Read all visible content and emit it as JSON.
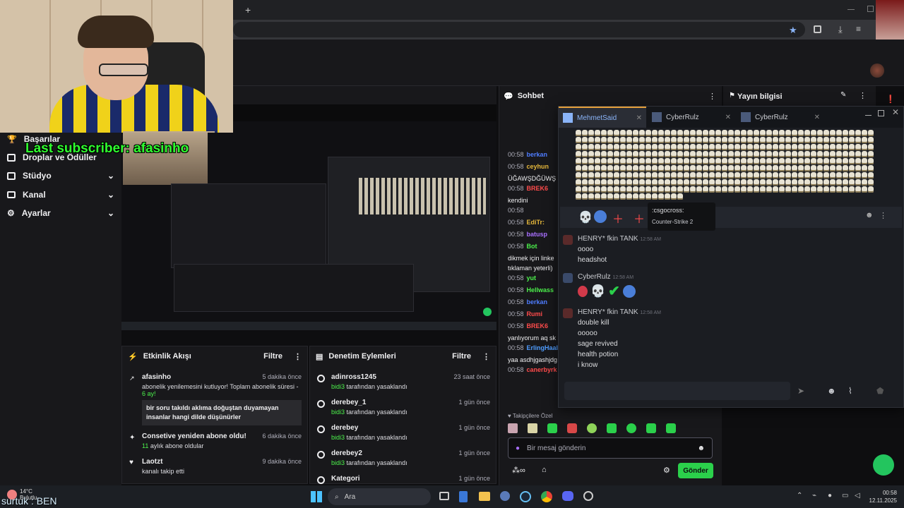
{
  "browser": {
    "new_tab_symbol": "+",
    "bookmark_icon": "star-icon"
  },
  "overlay": {
    "last_subscriber": "Last subscriber: afasinho",
    "bottom_label": "surtuk : BEN"
  },
  "sidebar": {
    "items": [
      {
        "label": "Başarılar",
        "icon": "trophy-icon",
        "chevron": false
      },
      {
        "label": "Droplar ve Ödüller",
        "icon": "gift-icon",
        "chevron": false
      },
      {
        "label": "Stüdyo",
        "icon": "film-icon",
        "chevron": true
      },
      {
        "label": "Kanal",
        "icon": "channel-icon",
        "chevron": true
      },
      {
        "label": "Ayarlar",
        "icon": "gear-icon",
        "chevron": true
      }
    ]
  },
  "activity": {
    "title": "Etkinlik Akışı",
    "filter_label": "Filtre",
    "events": [
      {
        "user": "afasinho",
        "time": "5 dakika önce",
        "text": "abonelik yenilemesini kutluyor! Toplam abonelik süresi - ",
        "highlight": "6 ay!",
        "message": "bir soru takıldı aklıma doğuştan duyamayan insanlar hangi dilde düşünürler"
      },
      {
        "user": "Consetive yeniden abone oldu!",
        "time": "6 dakika önce",
        "highlight": "11",
        "text": " aylık abone oldular"
      },
      {
        "user": "Laotzt",
        "time": "9 dakika önce",
        "text": "kanalı takip etti"
      }
    ]
  },
  "moderation": {
    "title": "Denetim Eylemleri",
    "filter_label": "Filtre",
    "actions": [
      {
        "user": "adinross1245",
        "time": "23 saat önce",
        "by": "bidi3",
        "text": " tarafından yasaklandı"
      },
      {
        "user": "derebey_1",
        "time": "1 gün önce",
        "by": "bidi3",
        "text": " tarafından yasaklandı"
      },
      {
        "user": "derebey",
        "time": "1 gün önce",
        "by": "bidi3",
        "text": " tarafından yasaklandı"
      },
      {
        "user": "derebey2",
        "time": "1 gün önce",
        "by": "bidi3",
        "text": " tarafından yasaklandı"
      },
      {
        "user": "Kategori",
        "time": "1 gün önce"
      }
    ]
  },
  "chat": {
    "title": "Sohbet",
    "lines": [
      {
        "time": "00:58",
        "user": "berkan",
        "color": "#4f7dff",
        "text": ""
      },
      {
        "time": "00:58",
        "user": "ceyhun",
        "color": "#e5b73b",
        "text": ""
      },
      {
        "time": "",
        "user": "",
        "color": "#efeff1",
        "text": "ÜĞAWŞDĞÜWŞ"
      },
      {
        "time": "00:58",
        "user": "BREK6",
        "color": "#ff4b4b",
        "text": ""
      },
      {
        "time": "",
        "user": "",
        "color": "#efeff1",
        "text": "kendini"
      },
      {
        "time": "00:58",
        "user": "",
        "color": "#efeff1",
        "text": ""
      },
      {
        "time": "00:58",
        "user": "EdiTr:",
        "color": "#e5b73b",
        "text": ""
      },
      {
        "time": "00:58",
        "user": "batusp",
        "color": "#a970ff",
        "text": ""
      },
      {
        "time": "00:58",
        "user": "Bot",
        "color": "#4cf24c",
        "text": ""
      },
      {
        "time": "",
        "user": "",
        "color": "#efeff1",
        "text": "dikmek için linke"
      },
      {
        "time": "",
        "user": "",
        "color": "#efeff1",
        "text": "tıklaman yeterli)"
      },
      {
        "time": "00:58",
        "user": "yut",
        "color": "#4cf24c",
        "text": ""
      },
      {
        "time": "00:58",
        "user": "Hellwass",
        "color": "#4cf24c",
        "text": ""
      },
      {
        "time": "00:58",
        "user": "berkan",
        "color": "#4f7dff",
        "text": ""
      },
      {
        "time": "00:58",
        "user": "Rumi",
        "color": "#ff4b4b",
        "text": ""
      },
      {
        "time": "00:58",
        "user": "BREK6",
        "color": "#ff4b4b",
        "text": ""
      },
      {
        "time": "",
        "user": "",
        "color": "#efeff1",
        "text": "yanlıyorum aq sk"
      },
      {
        "time": "00:58",
        "user": "ErlingHaal",
        "color": "#4f9dff",
        "text": ""
      },
      {
        "time": "",
        "user": "",
        "color": "#efeff1",
        "text": "yaa asdhjgashjdg"
      },
      {
        "time": "00:58",
        "user": "canerbyrk",
        "color": "#ff4b4b",
        "text": ""
      }
    ],
    "followers_label": "Takipçilere Özel",
    "input_placeholder": "Bir mesaj gönderin",
    "send_label": "Gönder"
  },
  "stream_info": {
    "title": "Yayın bilgisi"
  },
  "discord": {
    "tabs": [
      "MehmetSaid",
      "CyberRulz",
      "CyberRulz"
    ],
    "tooltip_name": ":csgocross:",
    "tooltip_game": "Counter-Strike 2",
    "messages": [
      {
        "author": "HENRY* fkin TANK",
        "time": "12:58 AM",
        "lines": [
          "oooo",
          "headshot"
        ]
      },
      {
        "author": "CyberRulz",
        "time": "12:58 AM",
        "lines": []
      },
      {
        "author": "HENRY* fkin TANK",
        "time": "12:58 AM",
        "lines": [
          "double kill",
          "ooooo",
          "sage revived",
          "health potion",
          "i know"
        ]
      }
    ]
  },
  "taskbar": {
    "weather_temp": "14°C",
    "weather_desc": "Bulutlu",
    "search_label": "Ara",
    "time": "00:58",
    "date": "12.11.2025"
  }
}
